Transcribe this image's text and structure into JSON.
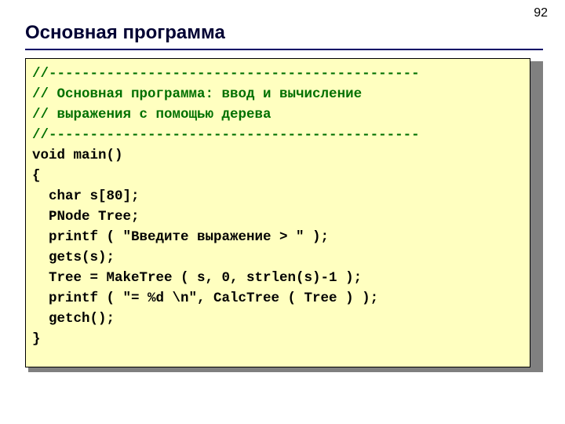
{
  "pageNumber": "92",
  "title": "Основная программа",
  "code": {
    "c1": "//---------------------------------------------",
    "c2": "// Основная программа: ввод и вычисление",
    "c3": "// выражения с помощью дерева",
    "c4": "//---------------------------------------------",
    "l5": "void main()",
    "l6": "{",
    "l7": "  char s[80];",
    "l8": "  PNode Tree;",
    "l9": "  printf ( \"Введите выражение > \" );",
    "l10": "  gets(s);",
    "l11": "  Tree = MakeTree ( s, 0, strlen(s)-1 );",
    "l12": "  printf ( \"= %d \\n\", CalcTree ( Tree ) );",
    "l13": "  getch();",
    "l14": "}"
  }
}
